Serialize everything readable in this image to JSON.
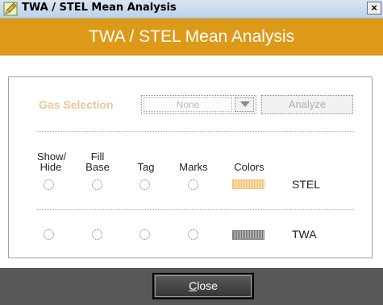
{
  "window": {
    "title": "TWA / STEL Mean Analysis",
    "close_glyph": "×",
    "icon": "pencil-app-icon"
  },
  "header": {
    "title": "TWA / STEL Mean Analysis",
    "background": "#dc9a18"
  },
  "gas_selection": {
    "label": "Gas Selection",
    "selected": "None",
    "analyze_label": "Analyze"
  },
  "columns": {
    "show_hide": [
      "Show/",
      "Hide"
    ],
    "fill_base": [
      "Fill",
      "Base"
    ],
    "tag": "Tag",
    "marks": "Marks",
    "colors": "Colors"
  },
  "rows": [
    {
      "label": "STEL",
      "swatch_color": "#f8c070"
    },
    {
      "label": "TWA",
      "swatch_color": "#707070"
    }
  ],
  "footer": {
    "close_label_first": "C",
    "close_label_rest": "lose"
  }
}
